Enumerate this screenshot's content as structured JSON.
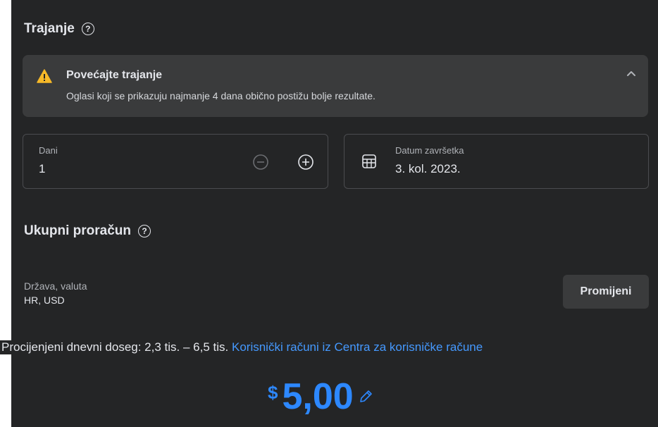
{
  "duration": {
    "title": "Trajanje",
    "help_icon": "?",
    "alert": {
      "icon": "warning-icon",
      "title": "Povećajte trajanje",
      "description": "Oglasi koji se prikazuju najmanje 4 dana obično postižu bolje rezultate."
    },
    "days": {
      "label": "Dani",
      "value": "1"
    },
    "end_date": {
      "label": "Datum završetka",
      "value": "3. kol. 2023."
    }
  },
  "budget": {
    "title": "Ukupni proračun",
    "help_icon": "?",
    "country_currency_label": "Država, valuta",
    "country_currency_value": "HR, USD",
    "change_button": "Promijeni",
    "reach_text": "Procijenjeni dnevni doseg: 2,3 tis. – 6,5 tis.",
    "reach_link": "Korisnički računi iz Centra za korisničke račune",
    "currency_symbol": "$",
    "amount": "5,00"
  },
  "colors": {
    "background": "#242526",
    "card": "#3a3b3c",
    "accent": "#2d88ff",
    "warning": "#f7b928"
  }
}
